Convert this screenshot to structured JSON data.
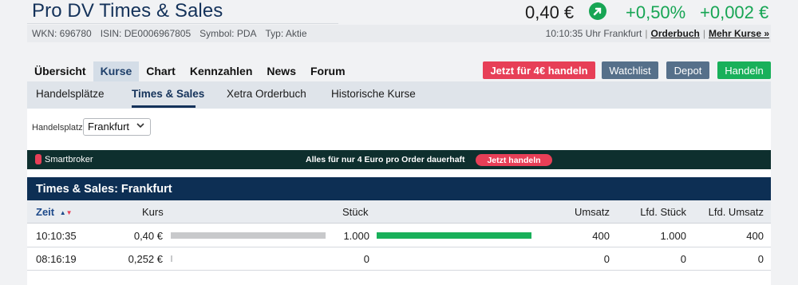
{
  "header": {
    "title": "Pro DV Times & Sales",
    "price": "0,40 €",
    "change_pct": "+0,50%",
    "change_abs": "+0,002 €",
    "trend_icon": "arrow-up-right-icon",
    "colors": {
      "positive": "#17a554",
      "brand": "#14325a"
    }
  },
  "meta": {
    "wkn": "WKN: 696780",
    "isin": "ISIN: DE0006967805",
    "symbol": "Symbol: PDA",
    "type": "Typ: Aktie",
    "time": "10:10:35 Uhr Frankfurt",
    "orderbuch": "Orderbuch",
    "separator": "|",
    "mehr_kurse": "Mehr Kurse »"
  },
  "tabs": [
    {
      "label": "Übersicht",
      "active": false
    },
    {
      "label": "Kurse",
      "active": true
    },
    {
      "label": "Chart",
      "active": false
    },
    {
      "label": "Kennzahlen",
      "active": false
    },
    {
      "label": "News",
      "active": false
    },
    {
      "label": "Forum",
      "active": false
    }
  ],
  "actions": {
    "trade4": "Jetzt für 4€ handeln",
    "watchlist": "Watchlist",
    "depot": "Depot",
    "handeln": "Handeln"
  },
  "subtabs": [
    {
      "label": "Handelsplätze",
      "active": false
    },
    {
      "label": "Times & Sales",
      "active": true
    },
    {
      "label": "Xetra Orderbuch",
      "active": false
    },
    {
      "label": "Historische Kurse",
      "active": false
    }
  ],
  "filter": {
    "label": "Handelsplatz:",
    "selected": "Frankfurt"
  },
  "banner": {
    "brand": "Smartbroker",
    "text": "Alles für nur 4 Euro pro Order dauerhaft",
    "cta": "Jetzt handeln"
  },
  "table": {
    "title": "Times & Sales: Frankfurt",
    "columns": {
      "zeit": "Zeit",
      "kurs": "Kurs",
      "stueck": "Stück",
      "umsatz": "Umsatz",
      "lfd_stueck": "Lfd. Stück",
      "lfd_umsatz": "Lfd. Umsatz"
    },
    "rows": [
      {
        "zeit": "10:10:35",
        "kurs": "0,40 €",
        "kurs_fill": 1.0,
        "stueck": "1.000",
        "stueck_fill": 1.0,
        "umsatz": "400",
        "lfd_stueck": "1.000",
        "lfd_umsatz": "400"
      },
      {
        "zeit": "08:16:19",
        "kurs": "0,252 €",
        "kurs_fill": 0.01,
        "stueck": "0",
        "stueck_fill": 0,
        "umsatz": "0",
        "lfd_stueck": "0",
        "lfd_umsatz": "0"
      }
    ]
  }
}
